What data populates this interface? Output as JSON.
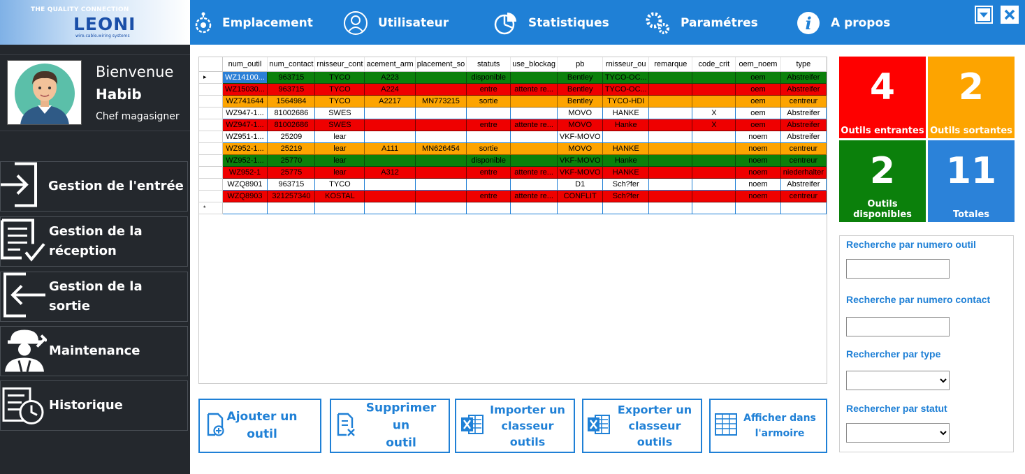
{
  "logo": {
    "tagline": "THE QUALITY CONNECTION",
    "brand": "LEONI",
    "subline": "wire.cable.wiring systems"
  },
  "nav": [
    {
      "label": "Emplacement",
      "icon": "location-gear-icon"
    },
    {
      "label": "Utilisateur",
      "icon": "user-icon"
    },
    {
      "label": "Statistiques",
      "icon": "pie-chart-icon"
    },
    {
      "label": "Paramétres",
      "icon": "gears-icon"
    },
    {
      "label": "A propos",
      "icon": "info-icon"
    }
  ],
  "window": {
    "minimize_icon": "chevron-down-icon",
    "close_icon": "close-icon"
  },
  "profile": {
    "welcome": "Bienvenue",
    "name": "Habib",
    "role": "Chef magasigner"
  },
  "sidebar": [
    {
      "label_lines": [
        "Gestion de l'entrée"
      ],
      "icon": "login-arrow-icon"
    },
    {
      "label_lines": [
        "Gestion de la",
        "réception"
      ],
      "icon": "checklist-icon"
    },
    {
      "label_lines": [
        "Gestion de la sortie"
      ],
      "icon": "logout-arrow-icon"
    },
    {
      "label_lines": [
        "Maintenance"
      ],
      "icon": "worker-icon"
    },
    {
      "label_lines": [
        "Historique"
      ],
      "icon": "history-clock-icon"
    }
  ],
  "grid": {
    "columns": [
      "num_outil",
      "num_contact",
      "fournisseur_contact",
      "emplacement_armoire",
      "emplacement_sortie",
      "statuts",
      "cause_blockage",
      "pb",
      "fournisseur_outil",
      "remarque",
      "code_crit",
      "oem_noem",
      "type"
    ],
    "column_display": [
      "num_outil",
      "num_contact",
      "rnisseur_cont",
      "acement_arm",
      "placement_so",
      "statuts",
      "use_blockag",
      "pb",
      "rnisseur_ou",
      "remarque",
      "code_crit",
      "oem_noem",
      "type"
    ],
    "rows": [
      {
        "status": "green",
        "cells": [
          "WZ14100...",
          "963715",
          "TYCO",
          "A223",
          "",
          "disponible",
          "",
          "Bentley",
          "TYCO-OC...",
          "",
          "",
          "oem",
          "Abstreifer"
        ]
      },
      {
        "status": "red",
        "cells": [
          "WZ15030...",
          "963715",
          "TYCO",
          "A224",
          "",
          "entre",
          "attente re...",
          "Bentley",
          "TYCO-OC...",
          "",
          "",
          "oem",
          "Abstreifer"
        ]
      },
      {
        "status": "orange",
        "cells": [
          "WZ741644",
          "1564984",
          "TYCO",
          "A2217",
          "MN773215",
          "sortie",
          "",
          "Bentley",
          "TYCO-HDI",
          "",
          "",
          "oem",
          "centreur"
        ]
      },
      {
        "status": "white",
        "cells": [
          "WZ947-1...",
          "81002686",
          "SWES",
          "",
          "",
          "",
          "",
          "MOVO",
          "HANKE",
          "",
          "X",
          "oem",
          "Abstreifer"
        ]
      },
      {
        "status": "red",
        "cells": [
          "WZ947-1...",
          "81002686",
          "SWES",
          "",
          "",
          "entre",
          "attente re...",
          "MOVO",
          "Hanke",
          "",
          "X",
          "oem",
          "Abstreifer"
        ]
      },
      {
        "status": "white",
        "cells": [
          "WZ951-1...",
          "25209",
          "lear",
          "",
          "",
          "",
          "",
          "VKF-MOVO",
          "",
          "",
          "",
          "noem",
          "Abstreifer"
        ]
      },
      {
        "status": "orange",
        "cells": [
          "WZ952-1...",
          "25219",
          "lear",
          "A111",
          "MN626454",
          "sortie",
          "",
          "MOVO",
          "HANKE",
          "",
          "",
          "noem",
          "centreur"
        ]
      },
      {
        "status": "green",
        "cells": [
          "WZ952-1...",
          "25770",
          "lear",
          "",
          "",
          "disponible",
          "",
          "VKF-MOVO",
          "Hanke",
          "",
          "",
          "noem",
          "centreur"
        ]
      },
      {
        "status": "red",
        "cells": [
          "WZ952-1",
          "25775",
          "lear",
          "A312",
          "",
          "entre",
          "attente re...",
          "VKF-MOVO",
          "HANKE",
          "",
          "",
          "noem",
          "niederhalter"
        ]
      },
      {
        "status": "white",
        "cells": [
          "WZQ8901",
          "963715",
          "TYCO",
          "",
          "",
          "",
          "",
          "D1",
          "Sch?fer",
          "",
          "",
          "noem",
          "Abstreifer"
        ]
      },
      {
        "status": "red",
        "cells": [
          "WZQ8903",
          "321257340",
          "KOSTAL",
          "",
          "",
          "entre",
          "attente re...",
          "CONFLIT",
          "Sch?fer",
          "",
          "",
          "noem",
          "centreur"
        ]
      }
    ],
    "current_row_marker": "▸",
    "new_row_marker": "*"
  },
  "actions": [
    {
      "label_lines": [
        "Ajouter un",
        "outil"
      ],
      "icon": "add-document-icon"
    },
    {
      "label_lines": [
        "Supprimer un",
        "outil"
      ],
      "icon": "delete-document-icon"
    },
    {
      "label_lines": [
        "Importer un",
        "classeur outils"
      ],
      "icon": "excel-icon"
    },
    {
      "label_lines": [
        "Exporter un",
        "classeur outils"
      ],
      "icon": "excel-icon"
    },
    {
      "label_lines": [
        "Afficher dans",
        "l'armoire"
      ],
      "icon": "cabinet-icon"
    }
  ],
  "stats": [
    {
      "value": "4",
      "label": "Outils entrantes",
      "color": "#fe0000"
    },
    {
      "value": "2",
      "label": "Outils sortantes",
      "color": "#fda400"
    },
    {
      "value": "2",
      "label": "Outils disponibles",
      "color": "#0b800b"
    },
    {
      "value": "11",
      "label": "Totales",
      "color": "#2b82d9"
    }
  ],
  "search": {
    "by_tool_number": {
      "label": "Recherche par numero outil",
      "value": ""
    },
    "by_contact_number": {
      "label": "Recherche par numero contact",
      "value": ""
    },
    "by_type": {
      "label": "Rechercher par type",
      "selected": ""
    },
    "by_status": {
      "label": "Rechercher par statut",
      "selected": ""
    }
  },
  "colors": {
    "accent": "#1f80d6",
    "sidebar": "#24282d"
  }
}
